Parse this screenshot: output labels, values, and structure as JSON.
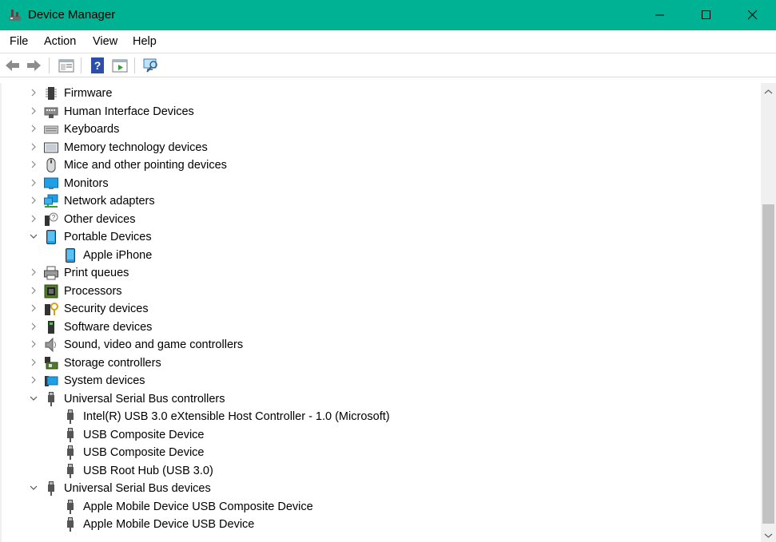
{
  "window": {
    "title": "Device Manager",
    "accent": "#00b294"
  },
  "menu": [
    "File",
    "Action",
    "View",
    "Help"
  ],
  "toolbar": [
    "back-icon",
    "forward-icon",
    "properties-icon",
    "help-icon",
    "update-driver-icon",
    "scan-hardware-icon"
  ],
  "tree": [
    {
      "label": "Firmware",
      "expanded": false,
      "level": 0,
      "icon": "firmware-icon"
    },
    {
      "label": "Human Interface Devices",
      "expanded": false,
      "level": 0,
      "icon": "hid-icon"
    },
    {
      "label": "Keyboards",
      "expanded": false,
      "level": 0,
      "icon": "keyboard-icon"
    },
    {
      "label": "Memory technology devices",
      "expanded": false,
      "level": 0,
      "icon": "memory-icon"
    },
    {
      "label": "Mice and other pointing devices",
      "expanded": false,
      "level": 0,
      "icon": "mouse-icon"
    },
    {
      "label": "Monitors",
      "expanded": false,
      "level": 0,
      "icon": "monitor-icon"
    },
    {
      "label": "Network adapters",
      "expanded": false,
      "level": 0,
      "icon": "network-icon"
    },
    {
      "label": "Other devices",
      "expanded": false,
      "level": 0,
      "icon": "other-devices-icon"
    },
    {
      "label": "Portable Devices",
      "expanded": true,
      "level": 0,
      "icon": "portable-device-icon"
    },
    {
      "label": "Apple iPhone",
      "level": 1,
      "icon": "portable-device-icon"
    },
    {
      "label": "Print queues",
      "expanded": false,
      "level": 0,
      "icon": "printer-icon"
    },
    {
      "label": "Processors",
      "expanded": false,
      "level": 0,
      "icon": "processor-icon"
    },
    {
      "label": "Security devices",
      "expanded": false,
      "level": 0,
      "icon": "security-icon"
    },
    {
      "label": "Software devices",
      "expanded": false,
      "level": 0,
      "icon": "software-device-icon"
    },
    {
      "label": "Sound, video and game controllers",
      "expanded": false,
      "level": 0,
      "icon": "speaker-icon"
    },
    {
      "label": "Storage controllers",
      "expanded": false,
      "level": 0,
      "icon": "storage-icon"
    },
    {
      "label": "System devices",
      "expanded": false,
      "level": 0,
      "icon": "system-icon"
    },
    {
      "label": "Universal Serial Bus controllers",
      "expanded": true,
      "level": 0,
      "icon": "usb-icon"
    },
    {
      "label": "Intel(R) USB 3.0 eXtensible Host Controller - 1.0 (Microsoft)",
      "level": 1,
      "icon": "usb-icon"
    },
    {
      "label": "USB Composite Device",
      "level": 1,
      "icon": "usb-icon"
    },
    {
      "label": "USB Composite Device",
      "level": 1,
      "icon": "usb-icon"
    },
    {
      "label": "USB Root Hub (USB 3.0)",
      "level": 1,
      "icon": "usb-icon"
    },
    {
      "label": "Universal Serial Bus devices",
      "expanded": true,
      "level": 0,
      "icon": "usb-icon"
    },
    {
      "label": "Apple Mobile Device USB Composite Device",
      "level": 1,
      "icon": "usb-icon"
    },
    {
      "label": "Apple Mobile Device USB Device",
      "level": 1,
      "icon": "usb-icon"
    }
  ]
}
